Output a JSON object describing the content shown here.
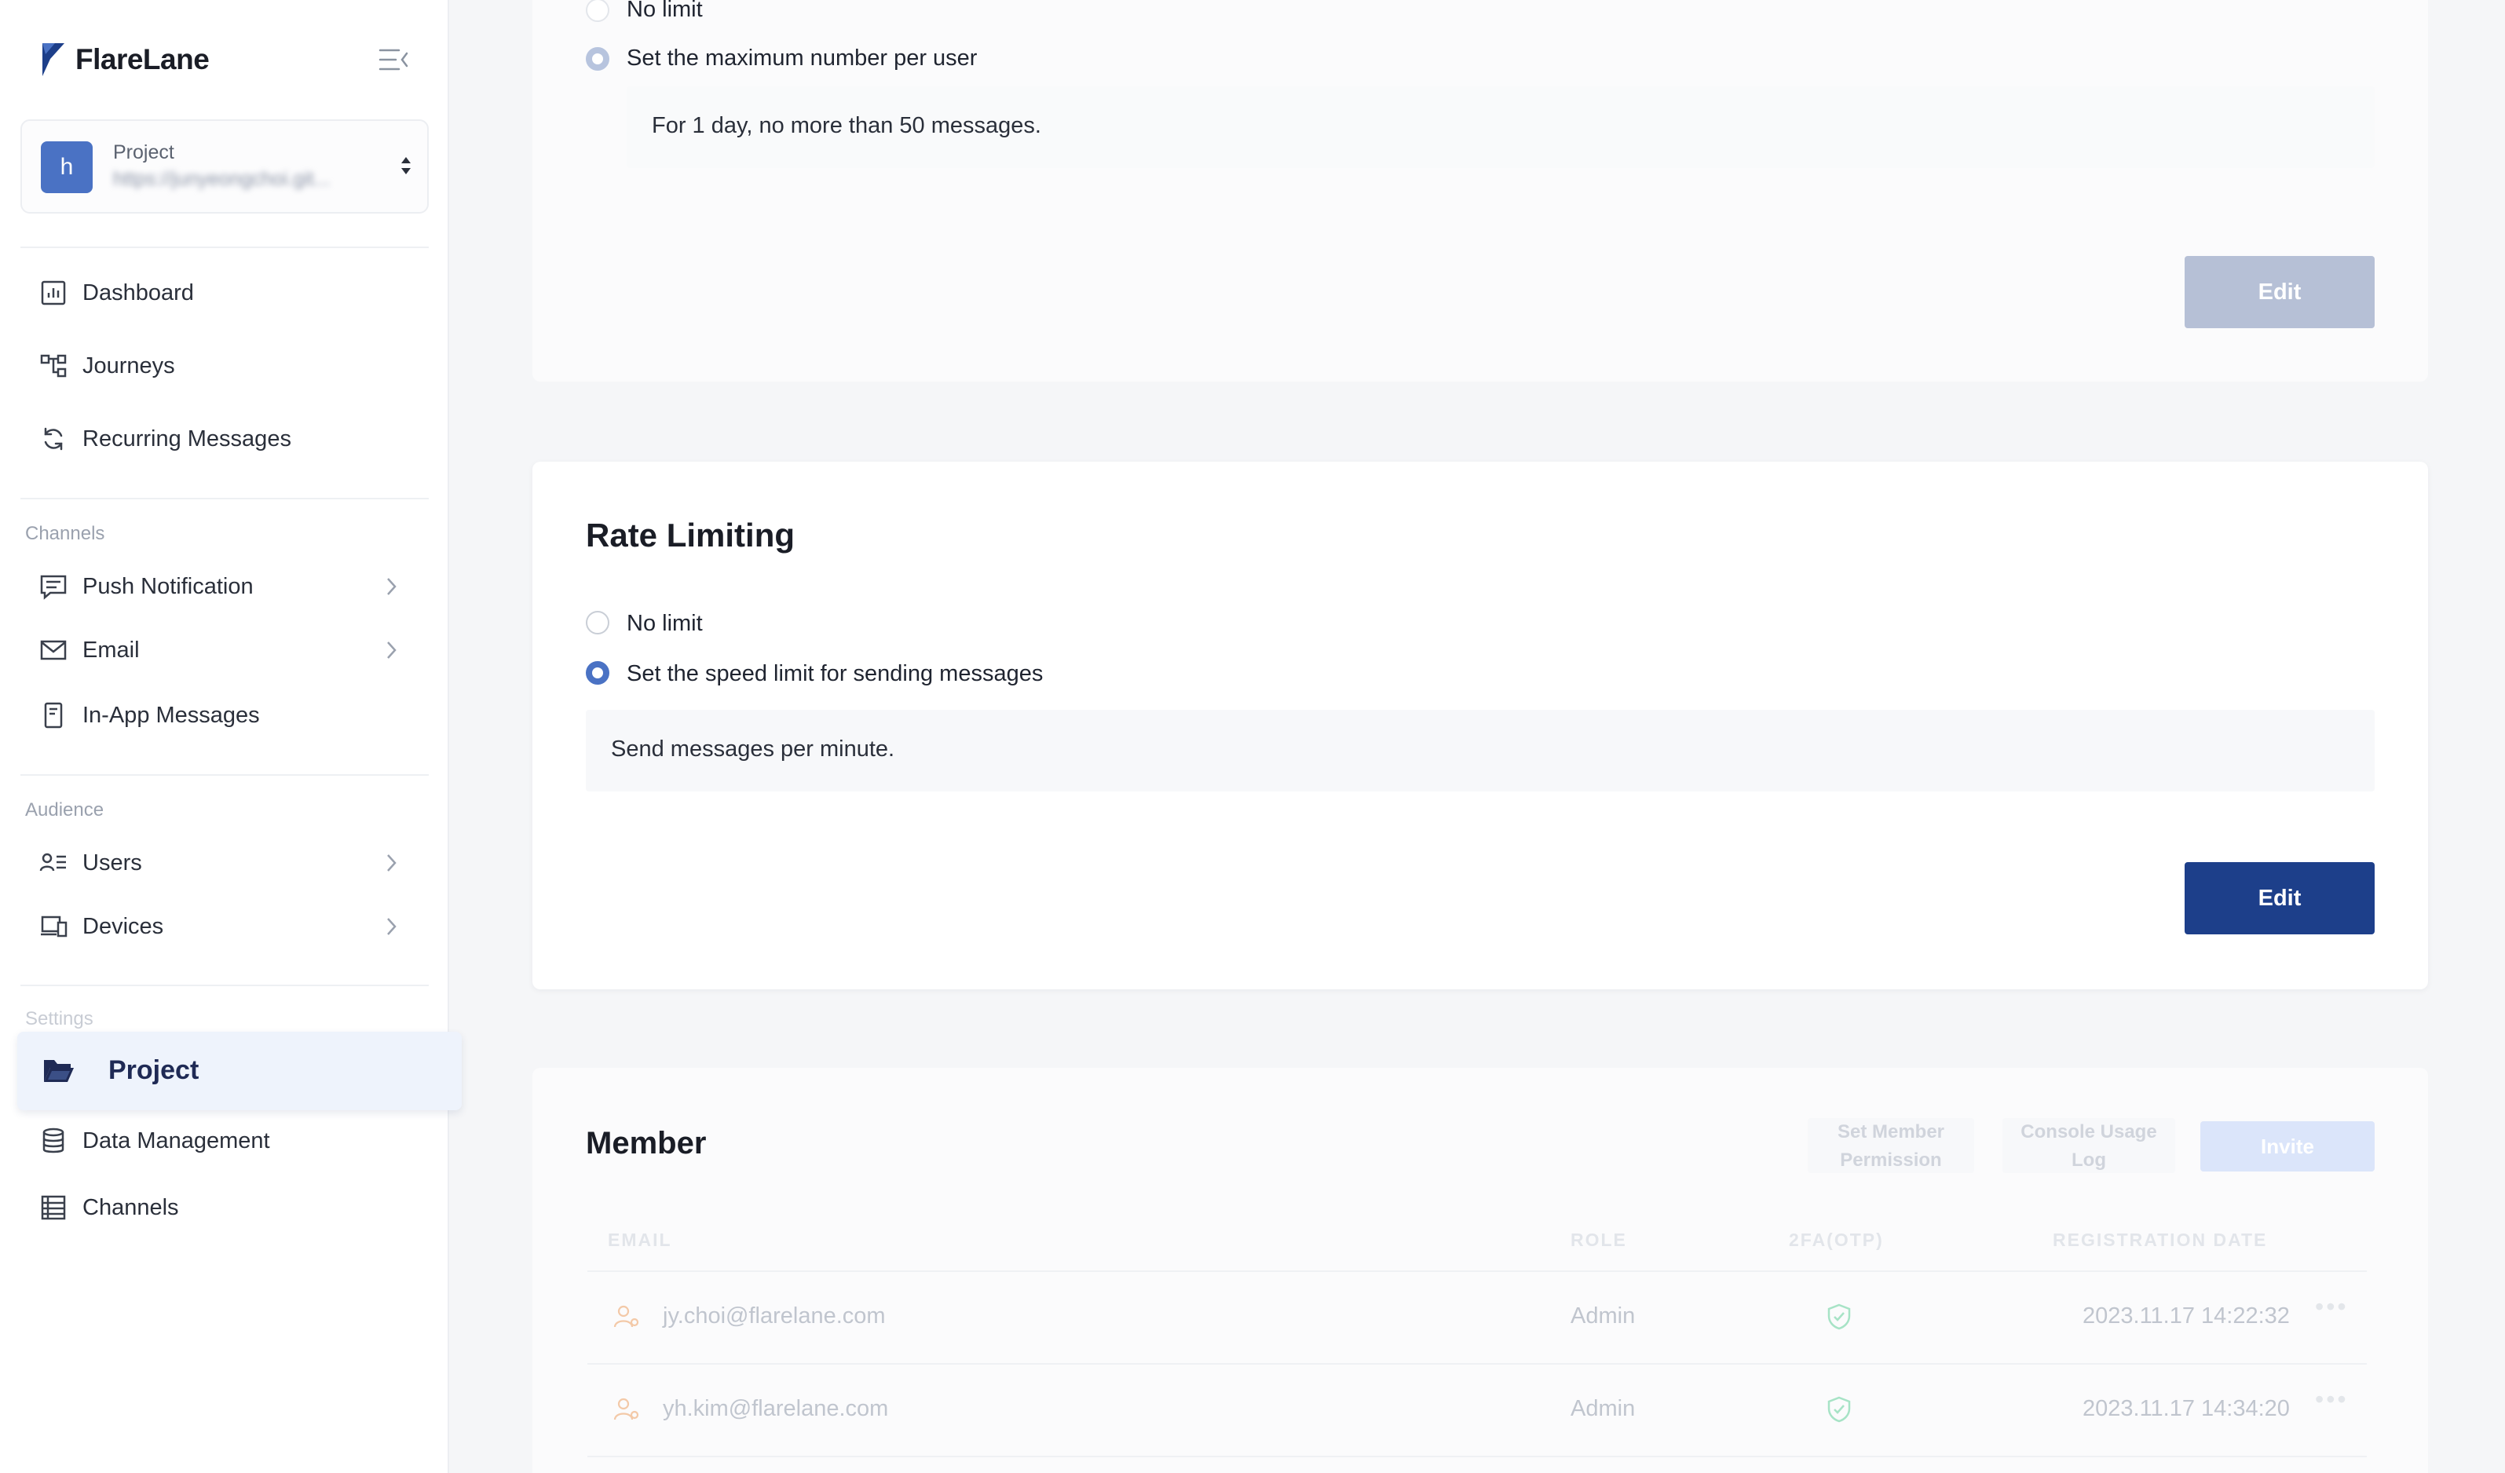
{
  "app": {
    "name": "FlareLane",
    "accent": "#1d3f8a",
    "brand_blue": "#4a72c4"
  },
  "project_switcher": {
    "avatar_letter": "h",
    "label": "Project",
    "url": "https://junyeongchoi.git..."
  },
  "nav": {
    "top": [
      {
        "label": "Dashboard",
        "icon": "chart-icon"
      },
      {
        "label": "Journeys",
        "icon": "flow-icon"
      },
      {
        "label": "Recurring Messages",
        "icon": "refresh-icon"
      }
    ],
    "channels_heading": "Channels",
    "channels": [
      {
        "label": "Push Notification",
        "icon": "message-icon"
      },
      {
        "label": "Email",
        "icon": "mail-icon"
      },
      {
        "label": "In-App Messages",
        "icon": "phone-icon"
      }
    ],
    "audience_heading": "Audience",
    "audience": [
      {
        "label": "Users",
        "icon": "users-icon"
      },
      {
        "label": "Devices",
        "icon": "devices-icon"
      }
    ],
    "settings_heading": "Settings",
    "settings": [
      {
        "label": "Project",
        "icon": "folder-icon",
        "active": true
      },
      {
        "label": "Data Management",
        "icon": "database-icon"
      },
      {
        "label": "Channels",
        "icon": "table-icon"
      }
    ]
  },
  "frequency_card": {
    "option_no_limit": "No limit",
    "option_max": "Set the maximum number per user",
    "info": "For 1 day, no more than 50 messages.",
    "edit_label": "Edit"
  },
  "rate_card": {
    "title": "Rate Limiting",
    "option_no_limit": "No limit",
    "option_speed": "Set the speed limit for sending messages",
    "info": "Send messages per minute.",
    "edit_label": "Edit"
  },
  "member_card": {
    "title": "Member",
    "set_permission": "Set Member Permission",
    "usage_log": "Console Usage Log",
    "invite": "Invite",
    "columns": [
      "EMAIL",
      "ROLE",
      "2FA(OTP)",
      "REGISTRATION DATE"
    ],
    "rows": [
      {
        "email": "jy.choi@flarelane.com",
        "role": "Admin",
        "date": "2023.11.17 14:22:32"
      },
      {
        "email": "yh.kim@flarelane.com",
        "role": "Admin",
        "date": "2023.11.17 14:34:20"
      }
    ]
  }
}
